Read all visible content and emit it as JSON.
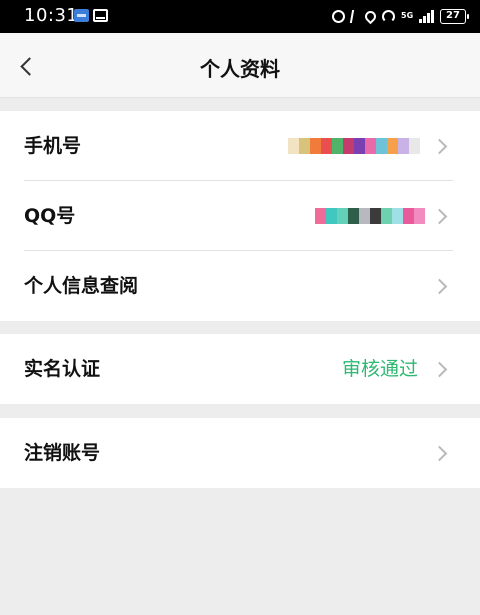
{
  "status_bar": {
    "time": "10:31",
    "network": "5G",
    "battery": "27",
    "icons": [
      "photo-app-icon",
      "mail-app-icon",
      "alarm-icon",
      "bluetooth-icon",
      "location-icon",
      "hotspot-icon",
      "signal-icon",
      "battery-icon"
    ]
  },
  "nav": {
    "title": "个人资料",
    "back_icon": "chevron-left-icon"
  },
  "groups": [
    {
      "rows": [
        {
          "label": "手机号",
          "value_redacted": true
        },
        {
          "label": "QQ号",
          "value_redacted": true
        },
        {
          "label": "个人信息查阅",
          "value": ""
        }
      ]
    },
    {
      "rows": [
        {
          "label": "实名认证",
          "value": "审核通过",
          "value_color": "#2eb872"
        }
      ]
    },
    {
      "rows": [
        {
          "label": "注销账号",
          "value": ""
        }
      ]
    }
  ],
  "colors": {
    "page_background": "#ededed",
    "accent_green": "#2eb872",
    "chevron": "#b9b9b9"
  }
}
